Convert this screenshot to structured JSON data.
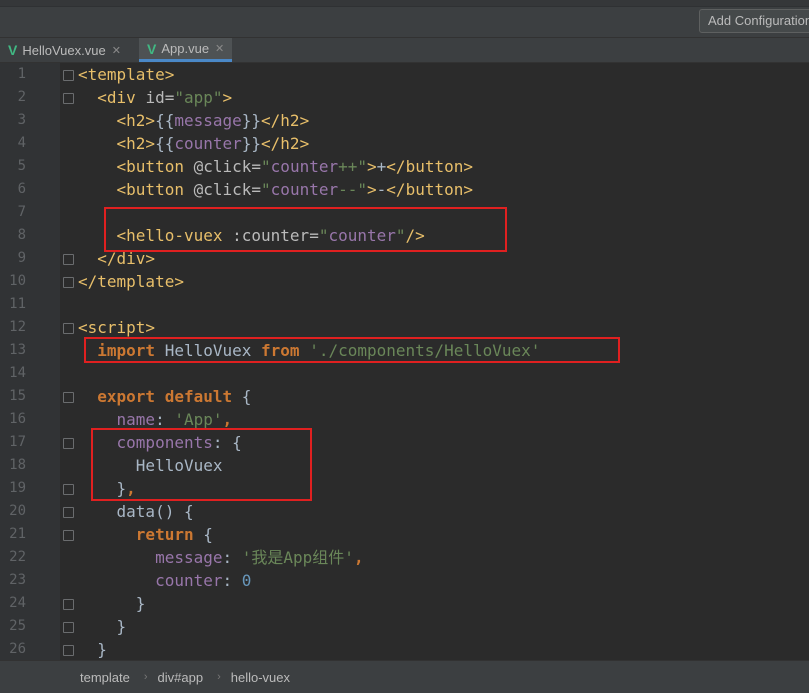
{
  "toolbar": {
    "add_configuration_label": "Add Configuration"
  },
  "tabs": [
    {
      "label": "HelloVuex.vue",
      "icon": "vue-file-icon",
      "active": false
    },
    {
      "label": "App.vue",
      "icon": "vue-file-icon",
      "active": true
    }
  ],
  "editor": {
    "line_numbers": [
      "1",
      "2",
      "3",
      "4",
      "5",
      "6",
      "7",
      "8",
      "9",
      "10",
      "11",
      "12",
      "13",
      "14",
      "15",
      "16",
      "17",
      "18",
      "19",
      "20",
      "21",
      "22",
      "23",
      "24",
      "25",
      "26"
    ],
    "lines": [
      [
        {
          "t": "<template>",
          "c": "tag"
        }
      ],
      [
        {
          "t": "  <div ",
          "c": "tag"
        },
        {
          "t": "id=",
          "c": "attr"
        },
        {
          "t": "\"app\"",
          "c": "str"
        },
        {
          "t": ">",
          "c": "tag"
        }
      ],
      [
        {
          "t": "    <h2>",
          "c": "tag"
        },
        {
          "t": "{{",
          "c": "plain"
        },
        {
          "t": "message",
          "c": "prop"
        },
        {
          "t": "}}",
          "c": "plain"
        },
        {
          "t": "</h2>",
          "c": "tag"
        }
      ],
      [
        {
          "t": "    <h2>",
          "c": "tag"
        },
        {
          "t": "{{",
          "c": "plain"
        },
        {
          "t": "counter",
          "c": "prop"
        },
        {
          "t": "}}",
          "c": "plain"
        },
        {
          "t": "</h2>",
          "c": "tag"
        }
      ],
      [
        {
          "t": "    <button ",
          "c": "tag"
        },
        {
          "t": "@click=",
          "c": "attr"
        },
        {
          "t": "\"",
          "c": "str"
        },
        {
          "t": "counter",
          "c": "prop"
        },
        {
          "t": "++\"",
          "c": "str"
        },
        {
          "t": ">",
          "c": "tag"
        },
        {
          "t": "+",
          "c": "plain"
        },
        {
          "t": "</button>",
          "c": "tag"
        }
      ],
      [
        {
          "t": "    <button ",
          "c": "tag"
        },
        {
          "t": "@click=",
          "c": "attr"
        },
        {
          "t": "\"",
          "c": "str"
        },
        {
          "t": "counter",
          "c": "prop"
        },
        {
          "t": "--\"",
          "c": "str"
        },
        {
          "t": ">",
          "c": "tag"
        },
        {
          "t": "-",
          "c": "plain"
        },
        {
          "t": "</button>",
          "c": "tag"
        }
      ],
      [],
      [
        {
          "t": "    <hello-vuex ",
          "c": "tag"
        },
        {
          "t": ":counter=",
          "c": "attr"
        },
        {
          "t": "\"",
          "c": "str"
        },
        {
          "t": "counter",
          "c": "prop"
        },
        {
          "t": "\"",
          "c": "str"
        },
        {
          "t": "/>",
          "c": "tag"
        }
      ],
      [
        {
          "t": "  </div>",
          "c": "tag"
        }
      ],
      [
        {
          "t": "</template>",
          "c": "tag"
        }
      ],
      [],
      [
        {
          "t": "<script>",
          "c": "tag"
        }
      ],
      [
        {
          "t": "  import ",
          "c": "kw"
        },
        {
          "t": "HelloVuex ",
          "c": "plain"
        },
        {
          "t": "from ",
          "c": "kw"
        },
        {
          "t": "'./components/HelloVuex'",
          "c": "str"
        }
      ],
      [],
      [
        {
          "t": "  export default ",
          "c": "kw"
        },
        {
          "t": "{",
          "c": "plain"
        }
      ],
      [
        {
          "t": "    name",
          "c": "prop"
        },
        {
          "t": ": ",
          "c": "plain"
        },
        {
          "t": "'App'",
          "c": "str"
        },
        {
          "t": ",",
          "c": "kw"
        }
      ],
      [
        {
          "t": "    components",
          "c": "prop"
        },
        {
          "t": ": {",
          "c": "plain"
        }
      ],
      [
        {
          "t": "      HelloVuex",
          "c": "plain"
        }
      ],
      [
        {
          "t": "    }",
          "c": "plain"
        },
        {
          "t": ",",
          "c": "kw"
        }
      ],
      [
        {
          "t": "    data",
          "c": "plain"
        },
        {
          "t": "() {",
          "c": "plain"
        }
      ],
      [
        {
          "t": "      return ",
          "c": "kw"
        },
        {
          "t": "{",
          "c": "plain"
        }
      ],
      [
        {
          "t": "        message",
          "c": "prop"
        },
        {
          "t": ": ",
          "c": "plain"
        },
        {
          "t": "'我是App组件'",
          "c": "str"
        },
        {
          "t": ",",
          "c": "kw"
        }
      ],
      [
        {
          "t": "        counter",
          "c": "prop"
        },
        {
          "t": ": ",
          "c": "plain"
        },
        {
          "t": "0",
          "c": "num"
        }
      ],
      [
        {
          "t": "      }",
          "c": "plain"
        }
      ],
      [
        {
          "t": "    }",
          "c": "plain"
        }
      ],
      [
        {
          "t": "  }",
          "c": "plain"
        }
      ]
    ]
  },
  "breadcrumb": [
    "template",
    "div#app",
    "hello-vuex"
  ],
  "colors": {
    "highlight_box": "#e02020",
    "vue_green": "#41b883",
    "editor_bg": "#2b2b2b"
  }
}
